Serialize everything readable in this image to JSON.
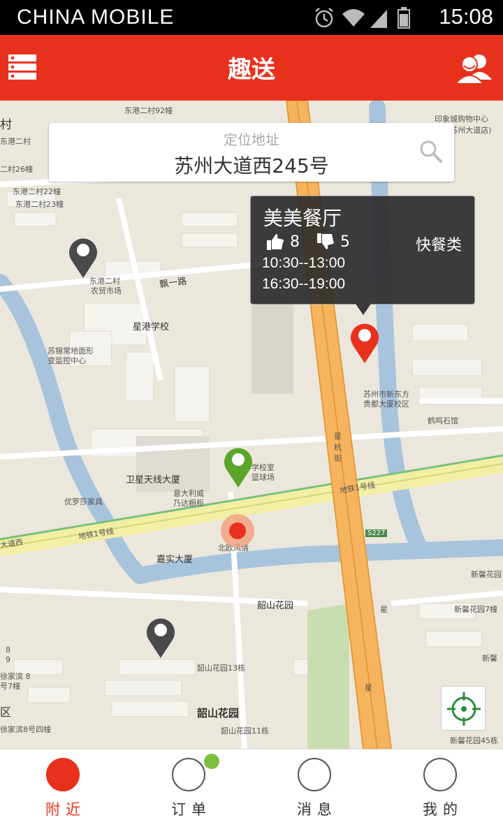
{
  "status_bar": {
    "carrier": "CHINA MOBILE",
    "time": "15:08"
  },
  "header": {
    "title": "趣送"
  },
  "search": {
    "hint": "定位地址",
    "value": "苏州大道西245号"
  },
  "popup": {
    "name": "美美餐厅",
    "likes": "8",
    "dislikes": "5",
    "category": "快餐类",
    "hours": [
      "10:30--13:00",
      "16:30--19:00"
    ]
  },
  "map_labels": {
    "dongganger92": "东港二村92幢",
    "village": "村",
    "dongganger": "东港二村",
    "dongganger26": "二村26幢",
    "donggang22": "东港二村22幢",
    "donggang23": "东港二村23幢",
    "market1": "东港二村",
    "market2": "农贸市场",
    "piaoyi": "飘一路",
    "xinggang": "星港学校",
    "substation1": "苏锡常地面形",
    "substation2": "变监控中心",
    "yinxiang1": "印象城购物中心",
    "yinxiang2": "(苏州大道店)",
    "guimansion1": "苏州市新东方",
    "guimansion2": "贵都大厦校区",
    "heming": "鹤鸣石馆",
    "xinghang1": "星",
    "xinghang2": "杭",
    "xinghang3": "街",
    "satellite": "卫星天线大厦",
    "school1": "学校室",
    "school2": "篮球场",
    "yourosha": "优罗莎家具",
    "italy1": "意大利威",
    "italy2": "乃达橱柜",
    "metro1": "地铁1号线",
    "metro2": "地铁1号线",
    "daoxi": "大道西",
    "beiou": "北欧风情",
    "jiashi": "嘉实大厦",
    "s227": "S227",
    "shaoshan": "韶山花园",
    "shaoshan13": "韶山花园13栋",
    "shaoshan_big": "韶山花园",
    "shaoshan11": "韶山花园11栋",
    "xinxin": "新馨花园",
    "xinxin_r": "新馨花园7幢",
    "xinxin45": "新馨花园45栋",
    "xinxin_edge": "新馨",
    "xu1": "徐家滨 8",
    "xu2": "号7幢",
    "xu3": "徐家滨8号四幢",
    "qu": "区",
    "num8": "8",
    "num9": "9"
  },
  "bottom_nav": {
    "tabs": [
      {
        "label": "附近",
        "active": true
      },
      {
        "label": "订单",
        "active": false,
        "badge": true
      },
      {
        "label": "消息",
        "active": false
      },
      {
        "label": "我的",
        "active": false
      }
    ]
  },
  "colors": {
    "brand_red": "#e8311d",
    "badge_green": "#7cbf3c",
    "pin_green": "#5aa52a",
    "pin_gray": "#4a4a4a"
  },
  "icons": {
    "menu": "list-menu-icon",
    "users": "users-icon",
    "search": "search-icon",
    "thumbs_up": "thumbs-up-icon",
    "thumbs_down": "thumbs-down-icon",
    "locate": "crosshair-icon"
  }
}
